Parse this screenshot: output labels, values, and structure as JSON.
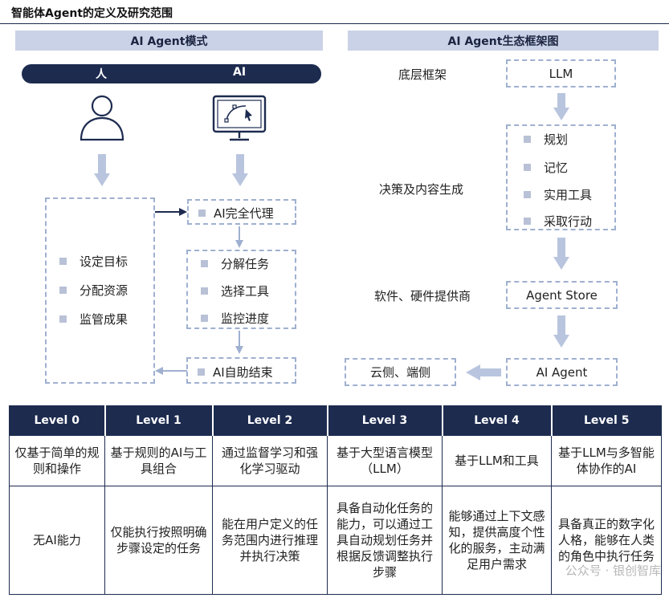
{
  "title": "智能体Agent的定义及研究范围",
  "left": {
    "heading": "AI Agent模式",
    "pill_left": "人",
    "pill_right": "AI",
    "human_items": [
      "设定目标",
      "分配资源",
      "监管成果"
    ],
    "ai_takeover": "AI完全代理",
    "ai_items": [
      "分解任务",
      "选择工具",
      "监控进度"
    ],
    "ai_end": "AI自助结束"
  },
  "right": {
    "heading": "AI Agent生态框架图",
    "layer_base": "底层框架",
    "llm": "LLM",
    "layer_decision": "决策及内容生成",
    "decision_items": [
      "规划",
      "记忆",
      "实用工具",
      "采取行动"
    ],
    "layer_provider": "软件、硬件提供商",
    "store": "Agent Store",
    "agent": "AI Agent",
    "cloud": "云侧、端侧"
  },
  "levels": {
    "headers": [
      "Level 0",
      "Level 1",
      "Level 2",
      "Level 3",
      "Level 4",
      "Level 5"
    ],
    "basis": [
      "仅基于简单的规则和操作",
      "基于规则的AI与工具组合",
      "通过监督学习和强化学习驱动",
      "基于大型语言模型（LLM）",
      "基于LLM和工具",
      "基于LLM与多智能体协作的AI"
    ],
    "capability": [
      "无AI能力",
      "仅能执行按照明确步骤设定的任务",
      "能在用户定义的任务范围内进行推理并执行决策",
      "具备自动化任务的能力，可以通过工具自动规划任务并根据反馈调整执行步骤",
      "能够通过上下文感知，提供高度个性化的服务，主动满足用户需求",
      "具备真正的数字化人格，能够在人类的角色中执行任务"
    ]
  },
  "watermark": "公众号 · 银创智库"
}
